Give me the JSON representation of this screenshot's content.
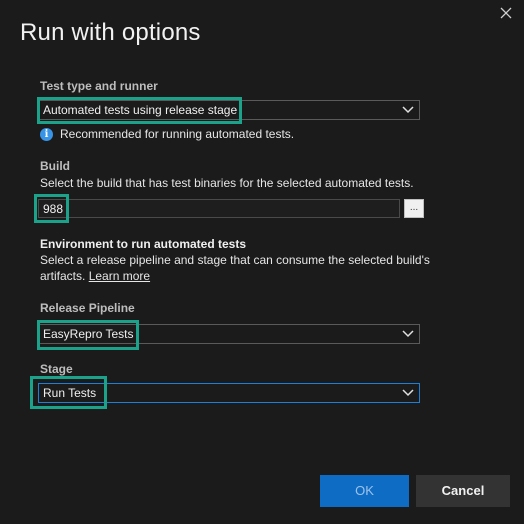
{
  "dialog": {
    "title": "Run with options",
    "close_icon": "close-icon"
  },
  "test_type": {
    "label": "Test type and runner",
    "selected": "Automated tests using release stage",
    "info_text": "Recommended for running automated tests.",
    "info_icon": "info-icon"
  },
  "build": {
    "label": "Build",
    "description": "Select the build that has test binaries for the selected automated tests.",
    "value": "988",
    "browse_label": "..."
  },
  "environment": {
    "heading": "Environment to run automated tests",
    "description_line1": "Select a release pipeline and stage that can consume the selected build's",
    "description_line2": "artifacts.",
    "learn_more": "Learn more"
  },
  "release_pipeline": {
    "label": "Release Pipeline",
    "selected": "EasyRepro Tests"
  },
  "stage": {
    "label": "Stage",
    "selected": "Run Tests"
  },
  "buttons": {
    "ok": "OK",
    "cancel": "Cancel"
  },
  "colors": {
    "background": "#1b1b1b",
    "highlight": "#1aa38a",
    "primary_button": "#0f6cc4",
    "focus_border": "#1e7fd6"
  }
}
